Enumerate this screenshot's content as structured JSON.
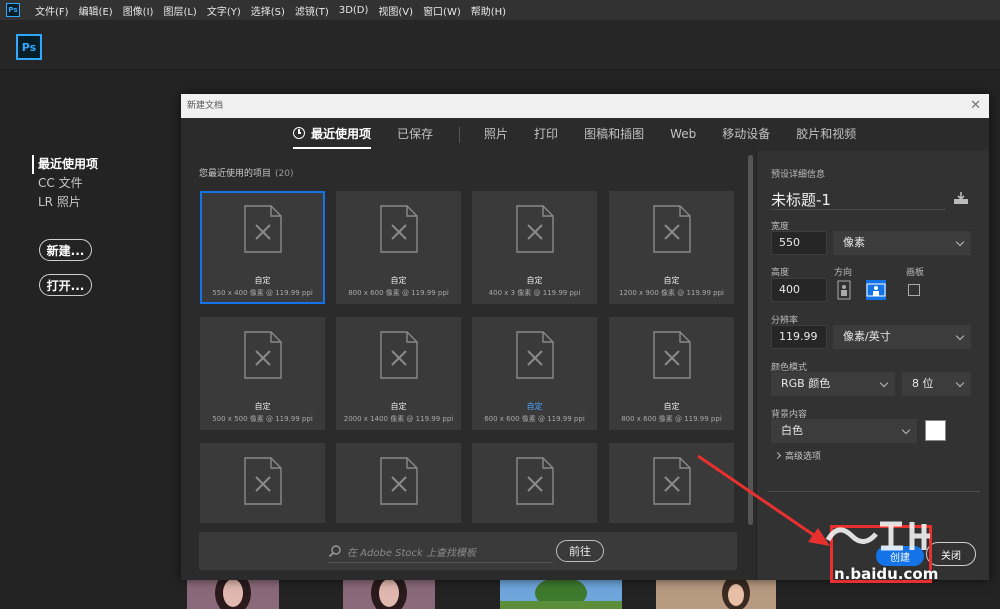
{
  "menubar": {
    "items": [
      "文件(F)",
      "编辑(E)",
      "图像(I)",
      "图层(L)",
      "文字(Y)",
      "选择(S)",
      "滤镜(T)",
      "3D(D)",
      "视图(V)",
      "窗口(W)",
      "帮助(H)"
    ]
  },
  "app": {
    "logo": "Ps"
  },
  "home": {
    "sidebar": [
      "最近使用项",
      "CC 文件",
      "LR 照片"
    ],
    "new_button": "新建...",
    "open_button": "打开..."
  },
  "dialog": {
    "title": "新建文档",
    "tabs": [
      "最近使用项",
      "已保存",
      "照片",
      "打印",
      "图稿和插图",
      "Web",
      "移动设备",
      "胶片和视频"
    ],
    "gallery": {
      "heading": "您最近使用的项目",
      "count": "(20)",
      "cards": [
        {
          "name": "自定",
          "dims": "550 x 400 像素 @ 119.99 ppi"
        },
        {
          "name": "自定",
          "dims": "800 x 600 像素 @ 119.99 ppi"
        },
        {
          "name": "自定",
          "dims": "400 x 3 像素 @ 119.99 ppi"
        },
        {
          "name": "自定",
          "dims": "1200 x 900 像素 @ 119.99 ppi"
        },
        {
          "name": "自定",
          "dims": "500 x 500 像素 @ 119.99 ppi"
        },
        {
          "name": "自定",
          "dims": "2000 x 1400 像素 @ 119.99 ppi"
        },
        {
          "name": "自定",
          "dims": "600 x 600 像素 @ 119.99 ppi"
        },
        {
          "name": "自定",
          "dims": "800 x 600 像素 @ 119.99 ppi"
        },
        {
          "name": "",
          "dims": ""
        },
        {
          "name": "",
          "dims": ""
        },
        {
          "name": "",
          "dims": ""
        },
        {
          "name": "",
          "dims": ""
        }
      ]
    },
    "stock": {
      "placeholder": "在 Adobe Stock 上查找模板",
      "go_button": "前往"
    },
    "preset": {
      "section_label": "预设详细信息",
      "doc_name": "未标题-1",
      "width_label": "宽度",
      "width_value": "550",
      "width_unit": "像素",
      "height_label": "高度",
      "height_value": "400",
      "orientation_label": "方向",
      "artboard_label": "画板",
      "resolution_label": "分辨率",
      "resolution_value": "119.99",
      "resolution_unit": "像素/英寸",
      "color_mode_label": "颜色模式",
      "color_mode_value": "RGB 颜色",
      "bit_depth_value": "8 位",
      "background_label": "背景内容",
      "background_value": "白色",
      "advanced_label": "高级选项"
    },
    "create_button": "创建",
    "close_button": "关闭"
  },
  "watermark": {
    "text": "n.baidu.com"
  },
  "colors": {
    "accent": "#1473e6",
    "annotation": "#e8302f"
  }
}
